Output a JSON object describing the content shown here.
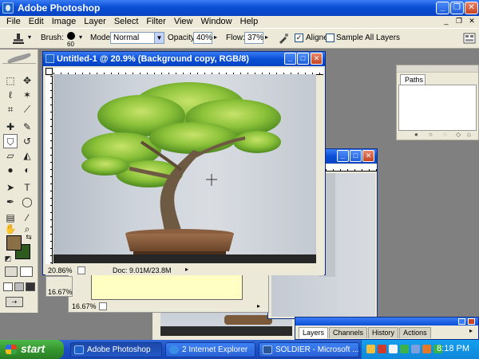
{
  "app": {
    "title": "Adobe Photoshop"
  },
  "menu": [
    "File",
    "Edit",
    "Image",
    "Layer",
    "Select",
    "Filter",
    "View",
    "Window",
    "Help"
  ],
  "options": {
    "brush_label": "Brush:",
    "brush_size": "60",
    "mode_label": "Mode:",
    "mode_value": "Normal",
    "opacity_label": "Opacity:",
    "opacity_value": "40%",
    "flow_label": "Flow:",
    "flow_value": "37%",
    "aligned_label": "Aligned",
    "aligned_checked": true,
    "sample_all_label": "Sample All Layers",
    "sample_all_checked": false
  },
  "doc_main": {
    "title": "Untitled-1 @ 20.9% (Background copy, RGB/8)",
    "zoom": "20.86%",
    "doc_size": "Doc: 9.01M/23.8M"
  },
  "doc_second": {
    "zoom": "16.67%"
  },
  "doc_third": {
    "zoom": "16.67%"
  },
  "panels": {
    "paths_tab": "Paths",
    "layers_tabs": [
      "Layers",
      "Channels",
      "History",
      "Actions"
    ]
  },
  "taskbar": {
    "start_label": "start",
    "tasks": [
      "Adobe Photoshop",
      "2 Internet Explorer",
      "SOLDIER - Microsoft ..."
    ],
    "clock": "8:18 PM"
  },
  "colors": {
    "foreground": "#8b6f47",
    "background": "#2f5a1e",
    "titlebar": "#0a4fd6",
    "taskbar": "#1c4fc4"
  },
  "icons": {
    "tools": [
      "marquee-icon",
      "move-icon",
      "lasso-icon",
      "magic-wand-icon",
      "crop-icon",
      "slice-icon",
      "healing-brush-icon",
      "brush-icon",
      "clone-stamp-icon",
      "history-brush-icon",
      "eraser-icon",
      "paint-bucket-icon",
      "blur-icon",
      "dodge-icon",
      "path-selection-icon",
      "type-icon",
      "pen-icon",
      "shape-icon",
      "notes-icon",
      "eyedropper-icon",
      "hand-icon",
      "zoom-icon"
    ]
  }
}
